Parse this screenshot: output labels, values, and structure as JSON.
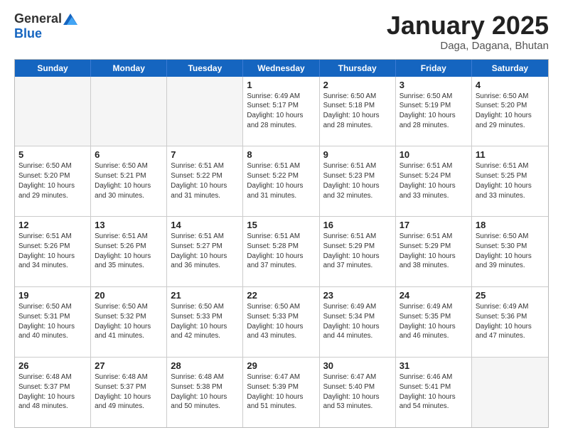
{
  "header": {
    "logo_general": "General",
    "logo_blue": "Blue",
    "month_title": "January 2025",
    "location": "Daga, Dagana, Bhutan"
  },
  "weekdays": [
    "Sunday",
    "Monday",
    "Tuesday",
    "Wednesday",
    "Thursday",
    "Friday",
    "Saturday"
  ],
  "rows": [
    [
      {
        "day": "",
        "info": "",
        "empty": true
      },
      {
        "day": "",
        "info": "",
        "empty": true
      },
      {
        "day": "",
        "info": "",
        "empty": true
      },
      {
        "day": "1",
        "info": "Sunrise: 6:49 AM\nSunset: 5:17 PM\nDaylight: 10 hours\nand 28 minutes.",
        "empty": false
      },
      {
        "day": "2",
        "info": "Sunrise: 6:50 AM\nSunset: 5:18 PM\nDaylight: 10 hours\nand 28 minutes.",
        "empty": false
      },
      {
        "day": "3",
        "info": "Sunrise: 6:50 AM\nSunset: 5:19 PM\nDaylight: 10 hours\nand 28 minutes.",
        "empty": false
      },
      {
        "day": "4",
        "info": "Sunrise: 6:50 AM\nSunset: 5:20 PM\nDaylight: 10 hours\nand 29 minutes.",
        "empty": false
      }
    ],
    [
      {
        "day": "5",
        "info": "Sunrise: 6:50 AM\nSunset: 5:20 PM\nDaylight: 10 hours\nand 29 minutes.",
        "empty": false
      },
      {
        "day": "6",
        "info": "Sunrise: 6:50 AM\nSunset: 5:21 PM\nDaylight: 10 hours\nand 30 minutes.",
        "empty": false
      },
      {
        "day": "7",
        "info": "Sunrise: 6:51 AM\nSunset: 5:22 PM\nDaylight: 10 hours\nand 31 minutes.",
        "empty": false
      },
      {
        "day": "8",
        "info": "Sunrise: 6:51 AM\nSunset: 5:22 PM\nDaylight: 10 hours\nand 31 minutes.",
        "empty": false
      },
      {
        "day": "9",
        "info": "Sunrise: 6:51 AM\nSunset: 5:23 PM\nDaylight: 10 hours\nand 32 minutes.",
        "empty": false
      },
      {
        "day": "10",
        "info": "Sunrise: 6:51 AM\nSunset: 5:24 PM\nDaylight: 10 hours\nand 33 minutes.",
        "empty": false
      },
      {
        "day": "11",
        "info": "Sunrise: 6:51 AM\nSunset: 5:25 PM\nDaylight: 10 hours\nand 33 minutes.",
        "empty": false
      }
    ],
    [
      {
        "day": "12",
        "info": "Sunrise: 6:51 AM\nSunset: 5:26 PM\nDaylight: 10 hours\nand 34 minutes.",
        "empty": false
      },
      {
        "day": "13",
        "info": "Sunrise: 6:51 AM\nSunset: 5:26 PM\nDaylight: 10 hours\nand 35 minutes.",
        "empty": false
      },
      {
        "day": "14",
        "info": "Sunrise: 6:51 AM\nSunset: 5:27 PM\nDaylight: 10 hours\nand 36 minutes.",
        "empty": false
      },
      {
        "day": "15",
        "info": "Sunrise: 6:51 AM\nSunset: 5:28 PM\nDaylight: 10 hours\nand 37 minutes.",
        "empty": false
      },
      {
        "day": "16",
        "info": "Sunrise: 6:51 AM\nSunset: 5:29 PM\nDaylight: 10 hours\nand 37 minutes.",
        "empty": false
      },
      {
        "day": "17",
        "info": "Sunrise: 6:51 AM\nSunset: 5:29 PM\nDaylight: 10 hours\nand 38 minutes.",
        "empty": false
      },
      {
        "day": "18",
        "info": "Sunrise: 6:50 AM\nSunset: 5:30 PM\nDaylight: 10 hours\nand 39 minutes.",
        "empty": false
      }
    ],
    [
      {
        "day": "19",
        "info": "Sunrise: 6:50 AM\nSunset: 5:31 PM\nDaylight: 10 hours\nand 40 minutes.",
        "empty": false
      },
      {
        "day": "20",
        "info": "Sunrise: 6:50 AM\nSunset: 5:32 PM\nDaylight: 10 hours\nand 41 minutes.",
        "empty": false
      },
      {
        "day": "21",
        "info": "Sunrise: 6:50 AM\nSunset: 5:33 PM\nDaylight: 10 hours\nand 42 minutes.",
        "empty": false
      },
      {
        "day": "22",
        "info": "Sunrise: 6:50 AM\nSunset: 5:33 PM\nDaylight: 10 hours\nand 43 minutes.",
        "empty": false
      },
      {
        "day": "23",
        "info": "Sunrise: 6:49 AM\nSunset: 5:34 PM\nDaylight: 10 hours\nand 44 minutes.",
        "empty": false
      },
      {
        "day": "24",
        "info": "Sunrise: 6:49 AM\nSunset: 5:35 PM\nDaylight: 10 hours\nand 46 minutes.",
        "empty": false
      },
      {
        "day": "25",
        "info": "Sunrise: 6:49 AM\nSunset: 5:36 PM\nDaylight: 10 hours\nand 47 minutes.",
        "empty": false
      }
    ],
    [
      {
        "day": "26",
        "info": "Sunrise: 6:48 AM\nSunset: 5:37 PM\nDaylight: 10 hours\nand 48 minutes.",
        "empty": false
      },
      {
        "day": "27",
        "info": "Sunrise: 6:48 AM\nSunset: 5:37 PM\nDaylight: 10 hours\nand 49 minutes.",
        "empty": false
      },
      {
        "day": "28",
        "info": "Sunrise: 6:48 AM\nSunset: 5:38 PM\nDaylight: 10 hours\nand 50 minutes.",
        "empty": false
      },
      {
        "day": "29",
        "info": "Sunrise: 6:47 AM\nSunset: 5:39 PM\nDaylight: 10 hours\nand 51 minutes.",
        "empty": false
      },
      {
        "day": "30",
        "info": "Sunrise: 6:47 AM\nSunset: 5:40 PM\nDaylight: 10 hours\nand 53 minutes.",
        "empty": false
      },
      {
        "day": "31",
        "info": "Sunrise: 6:46 AM\nSunset: 5:41 PM\nDaylight: 10 hours\nand 54 minutes.",
        "empty": false
      },
      {
        "day": "",
        "info": "",
        "empty": true
      }
    ]
  ]
}
